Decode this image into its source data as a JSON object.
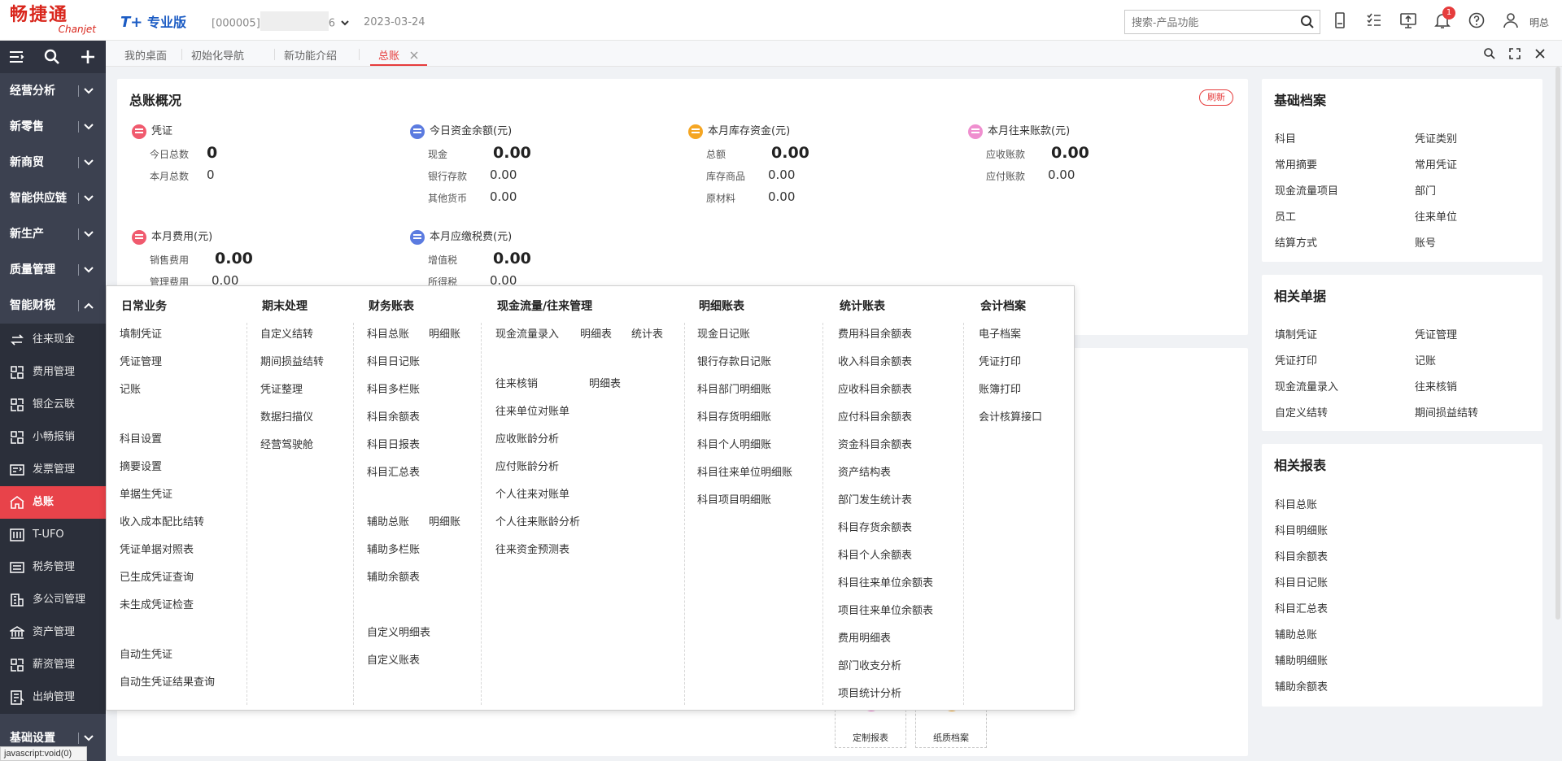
{
  "header": {
    "logo_cn": "畅捷通",
    "logo_en": "Chanjet",
    "product_tplus": "T+",
    "product_edition": "专业版",
    "account_code": "[000005]",
    "account_suffix": "6",
    "date": "2023-03-24",
    "search_placeholder": "搜索-产品功能",
    "notification_count": "1",
    "username": "明总"
  },
  "sidebar": {
    "groups": [
      {
        "label": "经营分析"
      },
      {
        "label": "新零售"
      },
      {
        "label": "新商贸"
      },
      {
        "label": "智能供应链"
      },
      {
        "label": "新生产"
      },
      {
        "label": "质量管理"
      },
      {
        "label": "智能财税"
      }
    ],
    "items": [
      {
        "label": "往来现金",
        "icon": "exchange-icon"
      },
      {
        "label": "费用管理",
        "icon": "expense-icon"
      },
      {
        "label": "银企云联",
        "icon": "bank-link-icon"
      },
      {
        "label": "小畅报销",
        "icon": "reimburse-icon"
      },
      {
        "label": "发票管理",
        "icon": "invoice-icon"
      },
      {
        "label": "总账",
        "icon": "ledger-icon",
        "active": true
      },
      {
        "label": "T-UFO",
        "icon": "report-icon"
      },
      {
        "label": "税务管理",
        "icon": "tax-icon"
      },
      {
        "label": "多公司管理",
        "icon": "company-icon"
      },
      {
        "label": "资产管理",
        "icon": "asset-icon"
      },
      {
        "label": "薪资管理",
        "icon": "salary-icon"
      },
      {
        "label": "出纳管理",
        "icon": "cashier-icon"
      }
    ],
    "bottom_group": "基础设置",
    "status_text": "javascript:void(0)"
  },
  "tabs": [
    {
      "label": "我的桌面"
    },
    {
      "label": "初始化导航"
    },
    {
      "label": "新功能介绍"
    },
    {
      "label": "总账",
      "active": true
    }
  ],
  "overview": {
    "title": "总账概况",
    "refresh": "刷新",
    "metrics": [
      {
        "title": "凭证",
        "color": "#f05a6e",
        "rows": [
          {
            "label": "今日总数",
            "value": "0"
          },
          {
            "label": "本月总数",
            "value": "0"
          }
        ]
      },
      {
        "title": "今日资金余额(元)",
        "color": "#5b7be0",
        "rows": [
          {
            "label": "现金",
            "value": "0.00"
          },
          {
            "label": "银行存款",
            "value": "0.00"
          },
          {
            "label": "其他货币",
            "value": "0.00"
          }
        ]
      },
      {
        "title": "本月库存资金(元)",
        "color": "#f5a623",
        "rows": [
          {
            "label": "总额",
            "value": "0.00"
          },
          {
            "label": "库存商品",
            "value": "0.00"
          },
          {
            "label": "原材料",
            "value": "0.00"
          }
        ]
      },
      {
        "title": "本月往来账款(元)",
        "color": "#ef8fcf",
        "rows": [
          {
            "label": "应收账款",
            "value": "0.00"
          },
          {
            "label": "应付账款",
            "value": "0.00"
          }
        ]
      },
      {
        "title": "本月费用(元)",
        "color": "#f05a6e",
        "rows": [
          {
            "label": "销售费用",
            "value": "0.00"
          },
          {
            "label": "管理费用",
            "value": "0.00"
          }
        ]
      },
      {
        "title": "本月应缴税费(元)",
        "color": "#5b7be0",
        "rows": [
          {
            "label": "增值税",
            "value": "0.00"
          },
          {
            "label": "所得税",
            "value": "0.00"
          }
        ]
      }
    ]
  },
  "right_panels": {
    "basic": {
      "title": "基础档案",
      "links": [
        "科目",
        "凭证类别",
        "常用摘要",
        "常用凭证",
        "现金流量项目",
        "部门",
        "员工",
        "往来单位",
        "结算方式",
        "账号"
      ]
    },
    "docs": {
      "title": "相关单据",
      "links": [
        "填制凭证",
        "凭证管理",
        "凭证打印",
        "记账",
        "现金流量录入",
        "往来核销",
        "自定义结转",
        "期间损益结转"
      ]
    },
    "reports": {
      "title": "相关报表",
      "links": [
        "科目总账",
        "科目明细账",
        "科目余额表",
        "科目日记账",
        "科目汇总表",
        "辅助总账",
        "辅助明细账",
        "辅助余额表"
      ]
    }
  },
  "mega_menu": {
    "columns": [
      {
        "title": "日常业务",
        "links": [
          "填制凭证",
          "凭证管理",
          "记账",
          "科目设置",
          "摘要设置",
          "单据生凭证",
          "收入成本配比结转",
          "凭证单据对照表",
          "已生成凭证查询",
          "未生成凭证检查",
          "自动生凭证",
          "自动生凭证结果查询"
        ]
      },
      {
        "title": "期末处理",
        "links": [
          "自定义结转",
          "期间损益结转",
          "凭证整理",
          "数据扫描仪",
          "经营驾驶舱"
        ]
      },
      {
        "title": "财务账表",
        "links": [
          "科目总账",
          "明细账",
          "科目日记账",
          "科目多栏账",
          "科目余额表",
          "科目日报表",
          "科目汇总表",
          "辅助总账",
          "明细账",
          "辅助多栏账",
          "辅助余额表",
          "自定义明细表",
          "自定义账表"
        ]
      },
      {
        "title": "现金流量/往来管理",
        "links": [
          "现金流量录入",
          "明细表",
          "统计表",
          "往来核销",
          "明细表",
          "往来单位对账单",
          "应收账龄分析",
          "应付账龄分析",
          "个人往来对账单",
          "个人往来账龄分析",
          "往来资金预测表"
        ]
      },
      {
        "title": "明细账表",
        "links": [
          "现金日记账",
          "银行存款日记账",
          "科目部门明细账",
          "科目存货明细账",
          "科目个人明细账",
          "科目往来单位明细账",
          "科目项目明细账"
        ]
      },
      {
        "title": "统计账表",
        "links": [
          "费用科目余额表",
          "收入科目余额表",
          "应收科目余额表",
          "应付科目余额表",
          "资金科目余额表",
          "资产结构表",
          "部门发生统计表",
          "科目存货余额表",
          "科目个人余额表",
          "科目往来单位余额表",
          "项目往来单位余额表",
          "费用明细表",
          "部门收支分析",
          "项目统计分析"
        ]
      },
      {
        "title": "会计档案",
        "links": [
          "电子档案",
          "凭证打印",
          "账簿打印",
          "会计核算接口"
        ]
      }
    ]
  },
  "quick": [
    {
      "label": "定制报表",
      "color": "#f07ad0"
    },
    {
      "label": "纸质档案",
      "color": "#f5a623"
    }
  ]
}
